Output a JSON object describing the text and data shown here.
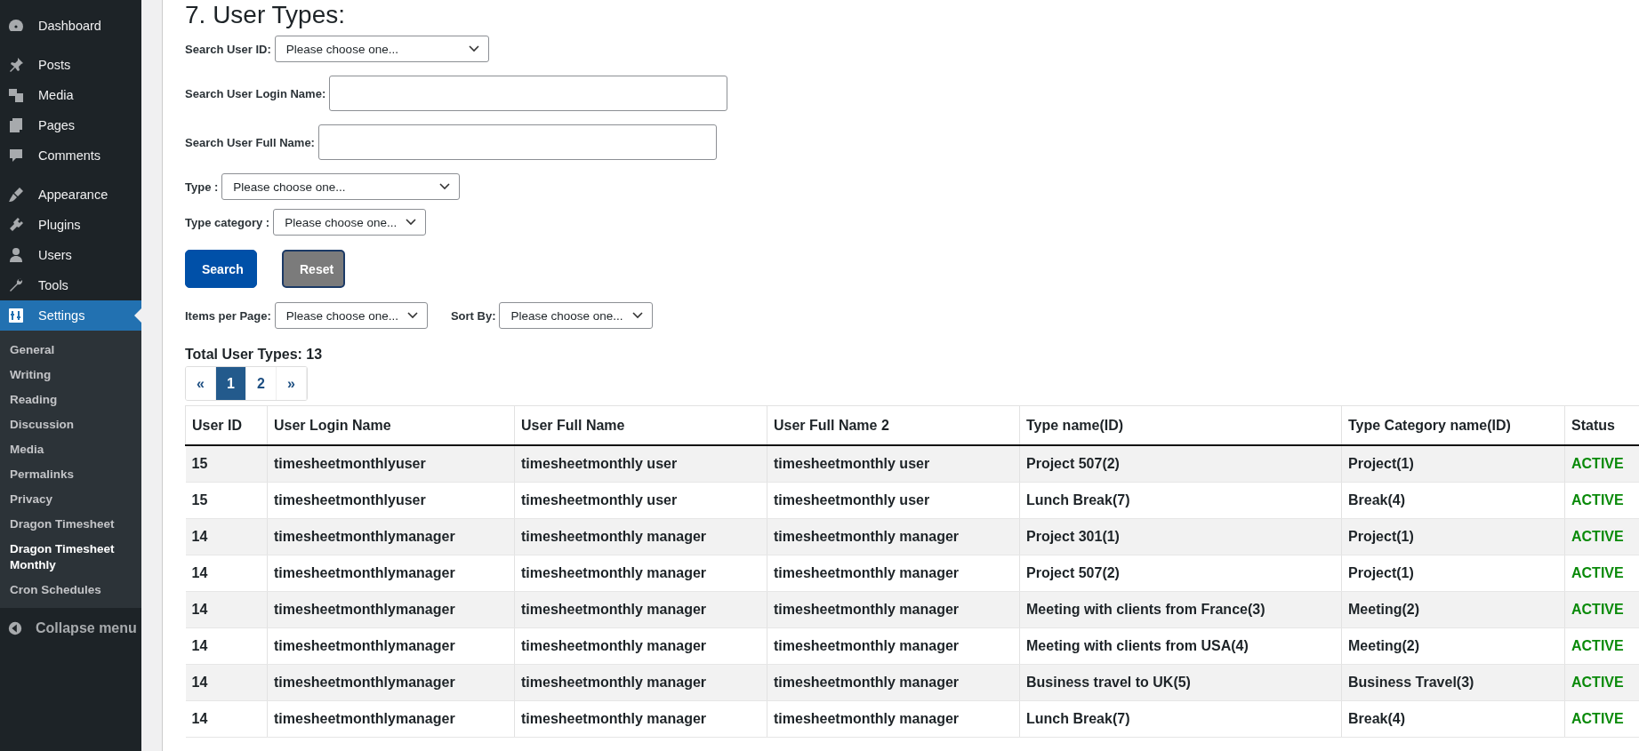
{
  "sidebar": {
    "menu_groups": [
      [
        {
          "label": "Dashboard",
          "selected": false
        }
      ],
      [
        {
          "label": "Posts",
          "selected": false
        },
        {
          "label": "Media",
          "selected": false
        },
        {
          "label": "Pages",
          "selected": false
        },
        {
          "label": "Comments",
          "selected": false
        }
      ],
      [
        {
          "label": "Appearance",
          "selected": false
        },
        {
          "label": "Plugins",
          "selected": false
        },
        {
          "label": "Users",
          "selected": false
        },
        {
          "label": "Tools",
          "selected": false
        },
        {
          "label": "Settings",
          "selected": true
        }
      ]
    ],
    "submenu": [
      {
        "label": "General",
        "selected": false
      },
      {
        "label": "Writing",
        "selected": false
      },
      {
        "label": "Reading",
        "selected": false
      },
      {
        "label": "Discussion",
        "selected": false
      },
      {
        "label": "Media",
        "selected": false
      },
      {
        "label": "Permalinks",
        "selected": false
      },
      {
        "label": "Privacy",
        "selected": false
      },
      {
        "label": "Dragon Timesheet",
        "selected": false
      },
      {
        "label": "Dragon Timesheet Monthly",
        "selected": true
      },
      {
        "label": "Cron Schedules",
        "selected": false
      }
    ],
    "collapse": "Collapse menu"
  },
  "title": "7. User Types:",
  "filters": [
    {
      "kind": "select",
      "label": "Search User ID:",
      "value": "Please choose one..."
    },
    {
      "kind": "text",
      "label": "Search User Login Name:"
    },
    {
      "kind": "text",
      "label": "Search User Full Name:"
    },
    {
      "kind": "select",
      "label": "Type :",
      "value": "Please choose one..."
    },
    {
      "kind": "select",
      "label": "Type category :",
      "value": "Please choose one..."
    }
  ],
  "buttons": {
    "search": "Search",
    "reset": "Reset"
  },
  "options": [
    {
      "label": "Items per Page:",
      "value": "Please choose one..."
    },
    {
      "label": "Sort By:",
      "value": "Please choose one..."
    }
  ],
  "total": "Total User Types: 13",
  "pagination": [
    {
      "label": "«",
      "selected": false
    },
    {
      "label": "1",
      "selected": true
    },
    {
      "label": "2",
      "selected": false
    },
    {
      "label": "»",
      "selected": false
    }
  ],
  "table": {
    "columns": [
      "User ID",
      "User Login Name",
      "User Full Name",
      "User Full Name 2",
      "Type name(ID)",
      "Type Category name(ID)",
      "Status"
    ],
    "rows": [
      [
        "15",
        "timesheetmonthlyuser",
        "timesheetmonthly user",
        "timesheetmonthly user",
        "Project 507(2)",
        "Project(1)",
        "ACTIVE"
      ],
      [
        "15",
        "timesheetmonthlyuser",
        "timesheetmonthly user",
        "timesheetmonthly user",
        "Lunch Break(7)",
        "Break(4)",
        "ACTIVE"
      ],
      [
        "14",
        "timesheetmonthlymanager",
        "timesheetmonthly manager",
        "timesheetmonthly manager",
        "Project 301(1)",
        "Project(1)",
        "ACTIVE"
      ],
      [
        "14",
        "timesheetmonthlymanager",
        "timesheetmonthly manager",
        "timesheetmonthly manager",
        "Project 507(2)",
        "Project(1)",
        "ACTIVE"
      ],
      [
        "14",
        "timesheetmonthlymanager",
        "timesheetmonthly manager",
        "timesheetmonthly manager",
        "Meeting with clients from France(3)",
        "Meeting(2)",
        "ACTIVE"
      ],
      [
        "14",
        "timesheetmonthlymanager",
        "timesheetmonthly manager",
        "timesheetmonthly manager",
        "Meeting with clients from USA(4)",
        "Meeting(2)",
        "ACTIVE"
      ],
      [
        "14",
        "timesheetmonthlymanager",
        "timesheetmonthly manager",
        "timesheetmonthly manager",
        "Business travel to UK(5)",
        "Business Travel(3)",
        "ACTIVE"
      ],
      [
        "14",
        "timesheetmonthlymanager",
        "timesheetmonthly manager",
        "timesheetmonthly manager",
        "Lunch Break(7)",
        "Break(4)",
        "ACTIVE"
      ]
    ]
  }
}
